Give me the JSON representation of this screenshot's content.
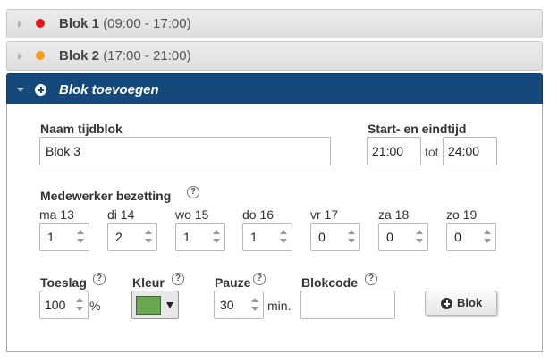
{
  "blocks": [
    {
      "name": "Blok 1",
      "time": "(09:00 - 17:00)",
      "color": "#e0181e"
    },
    {
      "name": "Blok 2",
      "time": "(17:00 - 21:00)",
      "color": "#f5a01a"
    }
  ],
  "add_block": {
    "title": "Blok toevoegen"
  },
  "form": {
    "name_label": "Naam tijdblok",
    "name_value": "Blok 3",
    "time_label": "Start- en eindtijd",
    "start_value": "21:00",
    "end_value": "24:00",
    "to_label": "tot",
    "staffing_label": "Medewerker bezetting",
    "days": [
      {
        "label": "ma 13",
        "value": "1"
      },
      {
        "label": "di 14",
        "value": "2"
      },
      {
        "label": "wo 15",
        "value": "1"
      },
      {
        "label": "do 16",
        "value": "1"
      },
      {
        "label": "vr 17",
        "value": "0"
      },
      {
        "label": "za 18",
        "value": "0"
      },
      {
        "label": "zo 19",
        "value": "0"
      }
    ],
    "surcharge_label": "Toeslag",
    "surcharge_value": "100",
    "surcharge_unit": "%",
    "color_label": "Kleur",
    "color_value": "#6aa84f",
    "pause_label": "Pauze",
    "pause_value": "30",
    "pause_unit": "min.",
    "code_label": "Blokcode",
    "code_value": "",
    "help_glyph": "?",
    "submit_label": "Blok"
  }
}
